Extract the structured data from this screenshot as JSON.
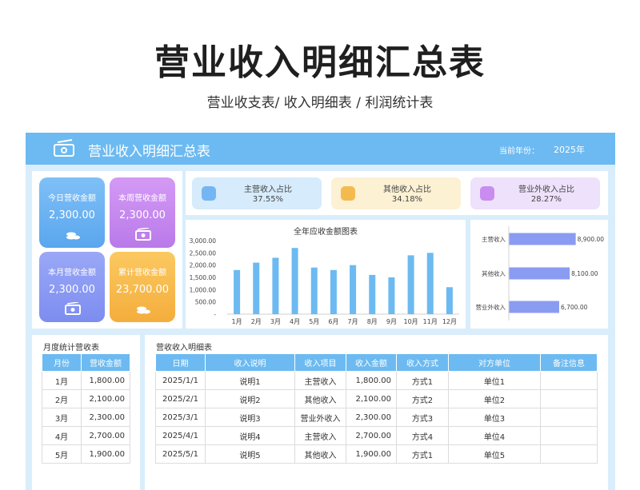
{
  "page": {
    "title": "营业收入明细汇总表",
    "subtitle": "营业收支表/ 收入明细表 / 利润统计表"
  },
  "header": {
    "title": "营业收入明细汇总表",
    "year_label": "当前年份：",
    "year": "2025年",
    "icon": "money-icon"
  },
  "stats": [
    {
      "label": "今日营收金额",
      "value": "2,300.00",
      "icon": "coins-icon",
      "color": "#74b6f4"
    },
    {
      "label": "本周营收金额",
      "value": "2,300.00",
      "icon": "cash-icon",
      "color": "#c98cf0"
    },
    {
      "label": "本月营收金额",
      "value": "2,300.00",
      "icon": "cash-icon",
      "color": "#8d9cf4"
    },
    {
      "label": "累计营收金额",
      "value": "23,700.00",
      "icon": "coins-icon",
      "color": "#f8bf55"
    }
  ],
  "shares": [
    {
      "label": "主营收入占比",
      "value": "37.55%",
      "bg": "#d6ebfb",
      "icon_color": "#74b6f4"
    },
    {
      "label": "其他收入占比",
      "value": "34.18%",
      "bg": "#fdf1d4",
      "icon_color": "#f3bb4f"
    },
    {
      "label": "营业外收入占比",
      "value": "28.27%",
      "bg": "#eee1fb",
      "icon_color": "#c98cf0"
    }
  ],
  "chart_data": [
    {
      "type": "bar",
      "title": "全年应收金额图表",
      "categories": [
        "1月",
        "2月",
        "3月",
        "4月",
        "5月",
        "6月",
        "7月",
        "8月",
        "9月",
        "10月",
        "11月",
        "12月"
      ],
      "values": [
        1800,
        2100,
        2300,
        2700,
        1900,
        1800,
        2000,
        1600,
        1500,
        2400,
        2500,
        1100
      ],
      "ylim": [
        0,
        3000
      ],
      "yticks": [
        "3,000.00",
        "2,500.00",
        "2,000.00",
        "1,500.00",
        "1,000.00",
        "500.00",
        "-"
      ],
      "color": "#6cbaf1"
    },
    {
      "type": "bar",
      "orientation": "horizontal",
      "categories": [
        "主营收入",
        "其他收入",
        "营业外收入"
      ],
      "values": [
        8900,
        8100,
        6700
      ],
      "value_labels": [
        "8,900.00",
        "8,100.00",
        "6,700.00"
      ],
      "xlim": [
        0,
        10000
      ],
      "color": "#8a9cf2"
    }
  ],
  "monthly": {
    "title": "月度统计营收表",
    "headers": [
      "月份",
      "营收金额"
    ],
    "rows": [
      [
        "1月",
        "1,800.00"
      ],
      [
        "2月",
        "2,100.00"
      ],
      [
        "3月",
        "2,300.00"
      ],
      [
        "4月",
        "2,700.00"
      ],
      [
        "5月",
        "1,900.00"
      ]
    ]
  },
  "detail": {
    "title": "营收收入明细表",
    "headers": [
      "日期",
      "收入说明",
      "收入项目",
      "收入金额",
      "收入方式",
      "对方单位",
      "备注信息"
    ],
    "rows": [
      [
        "2025/1/1",
        "说明1",
        "主营收入",
        "1,800.00",
        "方式1",
        "单位1",
        ""
      ],
      [
        "2025/2/1",
        "说明2",
        "其他收入",
        "2,100.00",
        "方式2",
        "单位2",
        ""
      ],
      [
        "2025/3/1",
        "说明3",
        "营业外收入",
        "2,300.00",
        "方式3",
        "单位3",
        ""
      ],
      [
        "2025/4/1",
        "说明4",
        "主营收入",
        "2,700.00",
        "方式4",
        "单位4",
        ""
      ],
      [
        "2025/5/1",
        "说明5",
        "其他收入",
        "1,900.00",
        "方式1",
        "单位5",
        ""
      ]
    ]
  }
}
